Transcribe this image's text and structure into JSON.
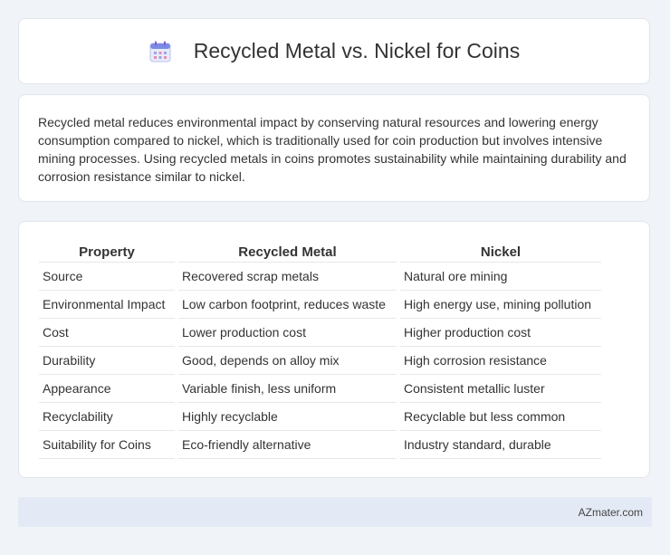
{
  "header": {
    "title": "Recycled Metal vs. Nickel for Coins",
    "icon": "calendar-icon"
  },
  "summary": {
    "text": "Recycled metal reduces environmental impact by conserving natural resources and lowering energy consumption compared to nickel, which is traditionally used for coin production but involves intensive mining processes. Using recycled metals in coins promotes sustainability while maintaining durability and corrosion resistance similar to nickel."
  },
  "table": {
    "headers": [
      "Property",
      "Recycled Metal",
      "Nickel"
    ],
    "rows": [
      [
        "Source",
        "Recovered scrap metals",
        "Natural ore mining"
      ],
      [
        "Environmental Impact",
        "Low carbon footprint, reduces waste",
        "High energy use, mining pollution"
      ],
      [
        "Cost",
        "Lower production cost",
        "Higher production cost"
      ],
      [
        "Durability",
        "Good, depends on alloy mix",
        "High corrosion resistance"
      ],
      [
        "Appearance",
        "Variable finish, less uniform",
        "Consistent metallic luster"
      ],
      [
        "Recyclability",
        "Highly recyclable",
        "Recyclable but less common"
      ],
      [
        "Suitability for Coins",
        "Eco-friendly alternative",
        "Industry standard, durable"
      ]
    ]
  },
  "footer": {
    "text": "AZmater.com"
  },
  "colors": {
    "background": "#f0f3f8",
    "card": "#ffffff",
    "footer": "#e4eaf5",
    "icon_accent": "#6b7fe0"
  }
}
